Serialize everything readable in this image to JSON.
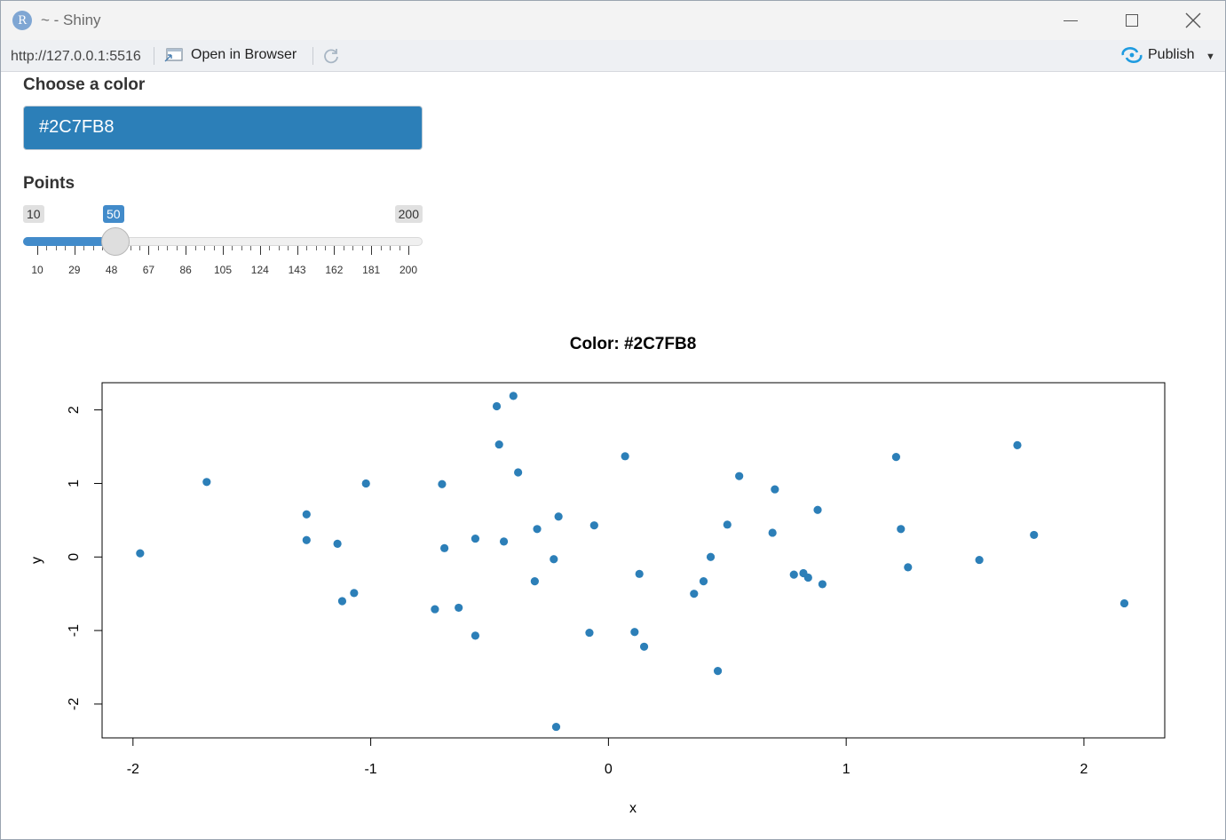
{
  "window": {
    "title": "~ - Shiny",
    "app_icon_letter": "R"
  },
  "toolbar": {
    "url": "http://127.0.0.1:5516",
    "open_browser_label": "Open in Browser",
    "publish_label": "Publish"
  },
  "color_picker": {
    "label": "Choose a color",
    "value": "#2C7FB8",
    "color": "#2C7FB8"
  },
  "points_slider": {
    "label": "Points",
    "min": "10",
    "max": "200",
    "value": "50",
    "ticks": [
      "10",
      "29",
      "48",
      "67",
      "86",
      "105",
      "124",
      "143",
      "162",
      "181",
      "200"
    ]
  },
  "chart_data": {
    "type": "scatter",
    "title": "Color: #2C7FB8",
    "xlabel": "x",
    "ylabel": "y",
    "xlim": [
      -2.13,
      2.34
    ],
    "ylim": [
      -2.46,
      2.37
    ],
    "xticks": [
      "-2",
      "-1",
      "0",
      "1",
      "2"
    ],
    "yticks": [
      "-2",
      "-1",
      "0",
      "1",
      "2"
    ],
    "point_color": "#2C7FB8",
    "grid": false,
    "legend": "none",
    "x": [
      -1.97,
      -1.69,
      -1.27,
      -1.27,
      -1.14,
      -1.12,
      -1.07,
      -1.02,
      -0.73,
      -0.7,
      -0.69,
      -0.63,
      -0.56,
      -0.56,
      -0.47,
      -0.46,
      -0.44,
      -0.4,
      -0.38,
      -0.31,
      -0.3,
      -0.23,
      -0.22,
      -0.21,
      -0.08,
      -0.06,
      0.07,
      0.11,
      0.13,
      0.15,
      0.36,
      0.4,
      0.43,
      0.46,
      0.5,
      0.55,
      0.69,
      0.7,
      0.78,
      0.82,
      0.84,
      0.88,
      0.9,
      1.21,
      1.23,
      1.26,
      1.56,
      1.72,
      1.79,
      2.17
    ],
    "y": [
      0.05,
      1.02,
      0.58,
      0.23,
      0.18,
      -0.6,
      -0.49,
      1.0,
      -0.71,
      0.99,
      0.12,
      -0.69,
      0.25,
      -1.07,
      2.05,
      1.53,
      0.21,
      2.19,
      1.15,
      -0.33,
      0.38,
      -0.03,
      -2.31,
      0.55,
      -1.03,
      0.43,
      1.37,
      -1.02,
      -0.23,
      -1.22,
      -0.5,
      -0.33,
      0.0,
      -1.55,
      0.44,
      1.1,
      0.33,
      0.92,
      -0.24,
      -0.22,
      -0.28,
      0.64,
      -0.37,
      1.36,
      0.38,
      -0.14,
      -0.04,
      1.52,
      0.3,
      -0.63
    ]
  }
}
